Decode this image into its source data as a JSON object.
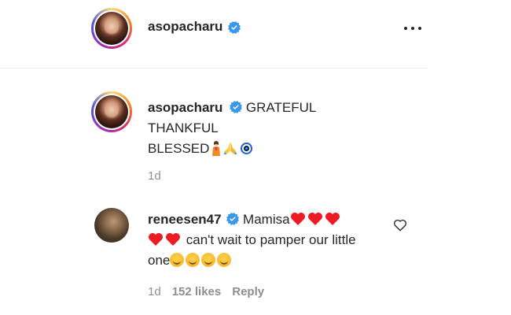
{
  "header": {
    "username": "asopacharu",
    "verified": true,
    "more_icon": "ellipsis-horizontal-icon"
  },
  "caption": {
    "username": "asopacharu",
    "line1": "GRATEFUL",
    "line2": "THANKFUL",
    "line3": "BLESSED",
    "emojis": [
      "woman-icon",
      "folded-hands-icon",
      "evil-eye-icon"
    ],
    "time": "1d"
  },
  "comment": {
    "username": "reneesen47",
    "text_start": "Mamisa",
    "text_mid": "can't wait to pamper our little one",
    "time": "1d",
    "likes": "152 likes",
    "reply_label": "Reply",
    "emojis": [
      "red-heart-icon",
      "smiling-face-with-open-hands-icon"
    ]
  },
  "colors": {
    "text": "#262626",
    "muted": "#8e8e8e",
    "verified_blue": "#3897f0",
    "heart_red": "#ed1c24"
  }
}
